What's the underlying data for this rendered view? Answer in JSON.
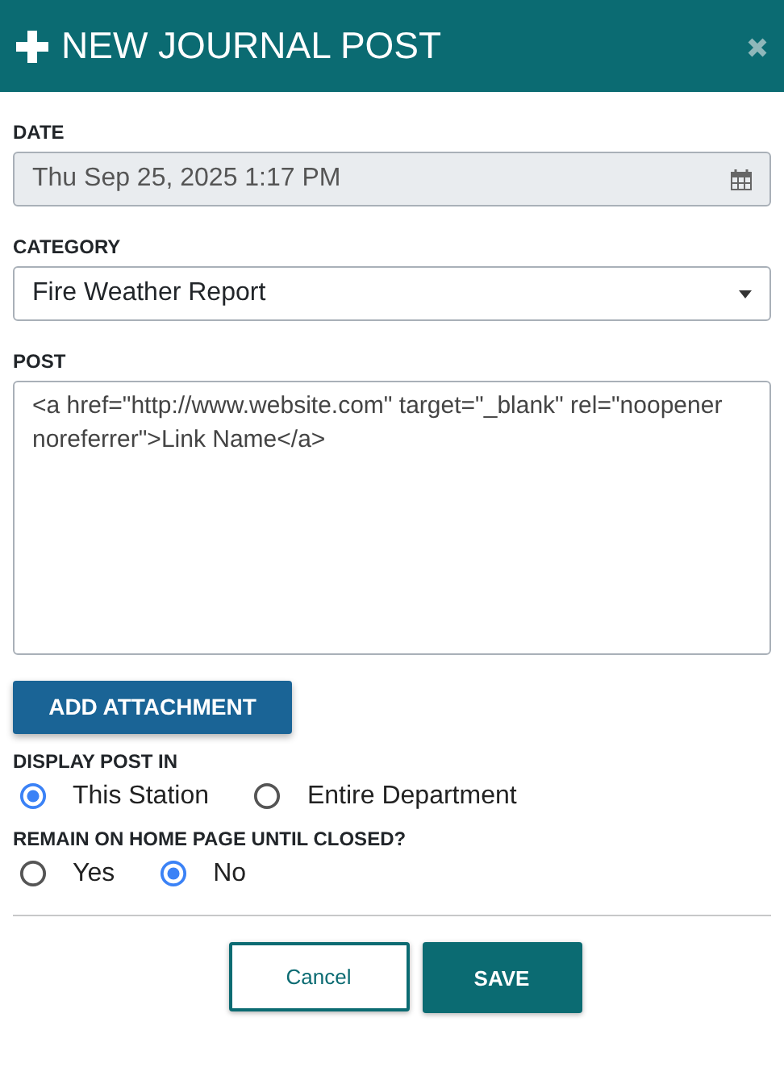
{
  "window": {
    "title": "NEW JOURNAL POST"
  },
  "date": {
    "label": "DATE",
    "value": "Thu Sep 25, 2025 1:17 PM",
    "disabled": true
  },
  "category": {
    "label": "CATEGORY",
    "value": "Fire Weather Report"
  },
  "post": {
    "label": "POST",
    "value": "<a href=\"http://www.website.com\" target=\"_blank\" rel=\"noopener noreferrer\">Link Name</a>"
  },
  "attachment_button": "ADD ATTACHMENT",
  "radio_groups": [
    {
      "label": "DISPLAY POST IN",
      "options": [
        {
          "label": "This Station",
          "selected": true
        },
        {
          "label": "Entire Department",
          "selected": false
        }
      ]
    },
    {
      "label": "REMAIN ON HOME PAGE UNTIL CLOSED?",
      "options": [
        {
          "label": "Yes",
          "selected": false
        },
        {
          "label": "No",
          "selected": true
        }
      ]
    }
  ],
  "buttons": [
    {
      "label": "Cancel",
      "kind": "secondary"
    },
    {
      "label": "SAVE",
      "kind": "primary"
    }
  ]
}
